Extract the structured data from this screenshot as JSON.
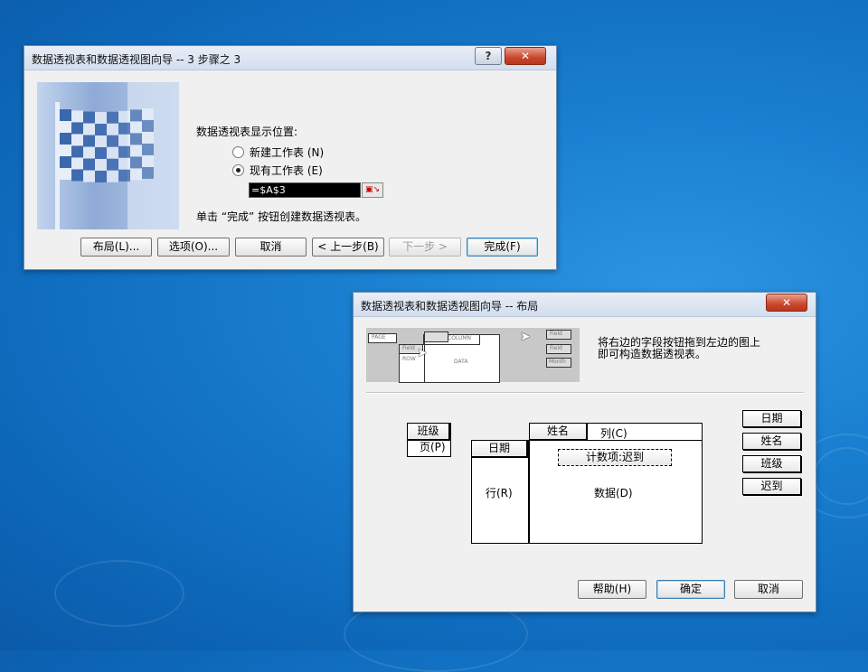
{
  "dialog1": {
    "title": "数据透视表和数据透视图向导 -- 3 步骤之 3",
    "help_button": "?",
    "close_button": "✕",
    "location_label": "数据透视表显示位置:",
    "option_new_sheet": "新建工作表 (N)",
    "option_existing_sheet": "现有工作表 (E)",
    "selected_option": "existing",
    "reference_value": "=$A$3",
    "hint": "单击 “完成” 按钮创建数据透视表。",
    "buttons": {
      "layout": "布局(L)...",
      "options": "选项(O)...",
      "cancel": "取消",
      "back": "< 上一步(B)",
      "next": "下一步 >",
      "finish": "完成(F)"
    }
  },
  "dialog2": {
    "title": "数据透视表和数据透视图向导 -- 布局",
    "close_button": "✕",
    "preview": {
      "page": "PAGE",
      "column": "COLUMN",
      "row": "ROW",
      "data": "DATA",
      "field_top": "Field",
      "field_small": "Field",
      "fields_mid": "Field",
      "month": "Month"
    },
    "instruction": "将右边的字段按钮拖到左边的图上\n即可构造数据透视表。",
    "page_area": {
      "field": "班级",
      "label": "页(P)"
    },
    "row_area": {
      "field": "日期",
      "label": "行(R)"
    },
    "column_area": {
      "field": "姓名",
      "label": "列(C)"
    },
    "data_area": {
      "field": "计数项:迟到",
      "label": "数据(D)"
    },
    "field_list": [
      "日期",
      "姓名",
      "班级",
      "迟到"
    ],
    "buttons": {
      "help": "帮助(H)",
      "ok": "确定",
      "cancel": "取消"
    }
  }
}
